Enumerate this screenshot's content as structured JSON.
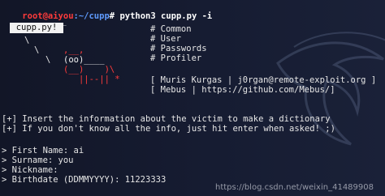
{
  "prompt": {
    "host": "root@aiyou",
    "path": ":~/cupp",
    "symbol": "# ",
    "command": "python3 cupp.py -i"
  },
  "banner": {
    "box_label": "cupp.py!",
    "dashes": "___________",
    "menu": [
      "# Common",
      "# User",
      "# Passwords",
      "# Profiler"
    ],
    "credits": [
      "[ Muris Kurgas | j0rgan@remote-exploit.org ]",
      "[ Mebus | https://github.com/Mebus/]"
    ]
  },
  "ascii": {
    "slash1": "\\",
    "slash2": "\\",
    "slash3": "\\",
    "row1_prefix": "        ",
    "row1": ",__,",
    "row2": "(oo)____",
    "row3": "(__)    )\\",
    "row4": "   ||--|| *"
  },
  "info": [
    "[+] Insert the information about the victim to make a dictionary",
    "[+] If you don't know all the info, just hit enter when asked! ;)"
  ],
  "fields": [
    "> First Name: ai",
    "> Surname: you",
    "> Nickname:",
    "> Birthdate (DDMMYYYY): 11223333"
  ],
  "watermark": "https://blog.csdn.net/weixin_41489908"
}
